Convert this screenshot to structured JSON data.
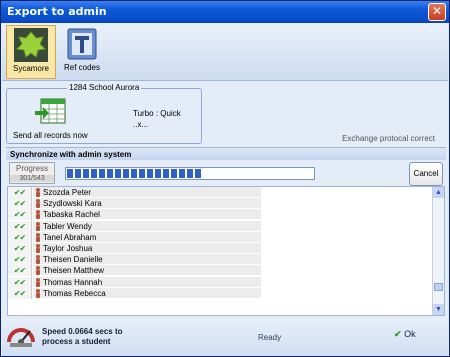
{
  "window": {
    "title": "Export to admin",
    "close_label": "✕"
  },
  "toolbar": [
    {
      "label": "Sycamore",
      "icon": "sycamore-leaf-icon",
      "active": true
    },
    {
      "label": "Ref codes",
      "icon": "ref-codes-T-icon",
      "active": false
    }
  ],
  "group": {
    "title": "1284 School Aurora",
    "send_label": "Send all records now",
    "turbo": "Turbo : Quick",
    "turbo_sub": "..x..."
  },
  "exchange_status": "Exchange protocal correct",
  "sync": {
    "header": "Synchronize with admin system",
    "progress_label": "Progress",
    "progress_count": "301/543",
    "progress_fraction": 0.554,
    "cancel_label": "Cancel"
  },
  "students": [
    {
      "name": "Szozda Peter",
      "check": "✔✔"
    },
    {
      "name": "Szydlowski Kara",
      "check": "✔✔"
    },
    {
      "name": "Tabaska Rachel",
      "check": "✔✔"
    },
    {
      "name": "Tabler Wendy",
      "check": "✔✔"
    },
    {
      "name": "Tanel Abraham",
      "check": "✔✔"
    },
    {
      "name": "Taylor Joshua",
      "check": "✔✔"
    },
    {
      "name": "Theisen Danielle",
      "check": "✔✔"
    },
    {
      "name": "Theisen Matthew",
      "check": "✔✔"
    },
    {
      "name": "Thomas Hannah",
      "check": "✔✔"
    },
    {
      "name": "Thomas Rebecca",
      "check": "✔✔"
    }
  ],
  "footer": {
    "speed_line1": "Speed 0.0664 secs to",
    "speed_line2": "process a student",
    "status": "Ready",
    "ok_label": "Ok"
  },
  "colors": {
    "title_bar": "#0b58d6",
    "accent": "#2f62c8",
    "check_green": "#2a9a2a"
  }
}
